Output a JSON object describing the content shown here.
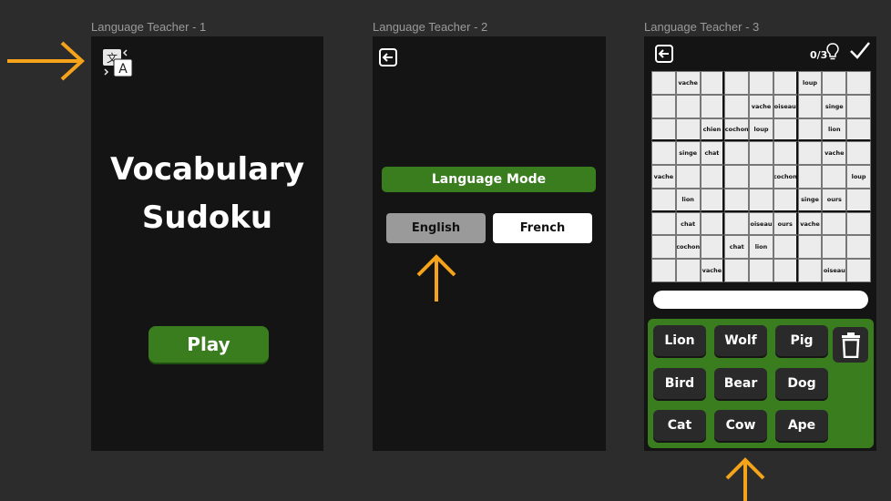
{
  "frames": [
    {
      "label": "Language Teacher - 1"
    },
    {
      "label": "Language Teacher - 2"
    },
    {
      "label": "Language Teacher - 3"
    }
  ],
  "screen1": {
    "title_line1": "Vocabulary",
    "title_line2": "Sudoku",
    "play_label": "Play",
    "translate_icon": "translate-icon"
  },
  "screen2": {
    "mode_label": "Language Mode",
    "english_label": "English",
    "french_label": "French",
    "back_icon": "back-icon"
  },
  "screen3": {
    "hint_count": "0/3",
    "grid": [
      [
        "",
        "vache",
        "",
        "",
        "",
        "",
        "loup",
        "",
        ""
      ],
      [
        "",
        "",
        "",
        "",
        "vache",
        "oiseau",
        "",
        "singe",
        ""
      ],
      [
        "",
        "",
        "chien",
        "cochon",
        "loup",
        "",
        "",
        "lion",
        ""
      ],
      [
        "",
        "singe",
        "chat",
        "",
        "",
        "",
        "",
        "vache",
        ""
      ],
      [
        "vache",
        "",
        "",
        "",
        "",
        "cochon",
        "",
        "",
        "loup"
      ],
      [
        "",
        "lion",
        "",
        "",
        "",
        "",
        "singe",
        "ours",
        ""
      ],
      [
        "",
        "chat",
        "",
        "",
        "oiseau",
        "ours",
        "vache",
        "",
        ""
      ],
      [
        "",
        "cochon",
        "",
        "chat",
        "lion",
        "",
        "",
        "",
        ""
      ],
      [
        "",
        "",
        "vache",
        "",
        "",
        "",
        "",
        "oiseau",
        ""
      ]
    ],
    "words": [
      "Lion",
      "Wolf",
      "Pig",
      "Bird",
      "Bear",
      "Dog",
      "Cat",
      "Cow",
      "Ape"
    ]
  },
  "colors": {
    "accent_green": "#3a7d1f",
    "annotation_orange": "#f5a31a",
    "frame_bg": "#141414"
  }
}
